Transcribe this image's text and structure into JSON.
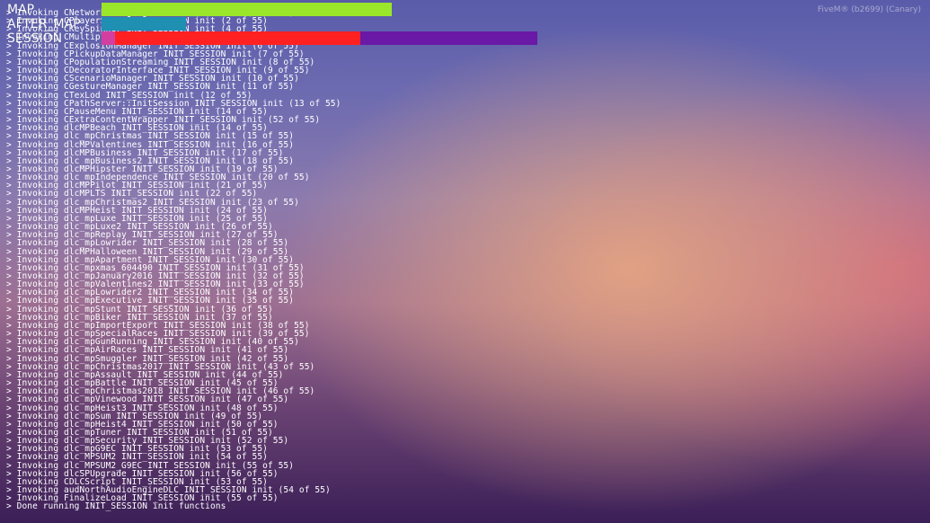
{
  "build_label": "FiveM® (b2699) (Canary)",
  "progress": {
    "map": {
      "label": "MAP",
      "fraction": 1.0,
      "color": "#9ae62a"
    },
    "after_map": {
      "label": "AFTER_MAP",
      "fraction": 0.42,
      "color": "#1f8fb2"
    },
    "session": {
      "label": "SESSION",
      "fraction": 0.59,
      "color": "#ff2121",
      "track_color": "#6a18a6"
    }
  },
  "log_lines": [
    "> Invoking CNetworkDebugMsg INIT_SESSION init (1 of 55)",
    "> Invoking CPlayerSync INIT_SESSION init (2 of 55)",
    "> Invoking CKeySpinner INIT_SESSION init (4 of 55)",
    "> Invoking CMultiplayerGamerTagHud INIT_SESSION init (5 of 55)",
    "> Invoking CExplosionManager INIT_SESSION init (6 of 55)",
    "> Invoking CPickupDataManager INIT_SESSION init (7 of 55)",
    "> Invoking CPopulationStreaming INIT_SESSION init (8 of 55)",
    "> Invoking CDecoratorInterface INIT_SESSION init (9 of 55)",
    "> Invoking CScenarioManager INIT_SESSION init (10 of 55)",
    "> Invoking CGestureManager INIT_SESSION init (11 of 55)",
    "> Invoking CTexLod INIT_SESSION init (12 of 55)",
    "> Invoking CPathServer::InitSession INIT_SESSION init (13 of 55)",
    "> Invoking CPauseMenu INIT_SESSION init (14 of 55)",
    "> Invoking CExtraContentWrapper INIT_SESSION init (52 of 55)",
    "> Invoking dlcMPBeach INIT_SESSION init (14 of 55)",
    "> Invoking dlc_mpChristmas INIT_SESSION init (15 of 55)",
    "> Invoking dlcMPValentines INIT_SESSION init (16 of 55)",
    "> Invoking dlcMPBusiness INIT_SESSION init (17 of 55)",
    "> Invoking dlc_mpBusiness2 INIT_SESSION init (18 of 55)",
    "> Invoking dlcMPHipster INIT_SESSION init (19 of 55)",
    "> Invoking dlc_mpIndependence INIT_SESSION init (20 of 55)",
    "> Invoking dlcMPPilot INIT_SESSION init (21 of 55)",
    "> Invoking dlcMPLTS INIT_SESSION init (22 of 55)",
    "> Invoking dlc_mpChristmas2 INIT_SESSION init (23 of 55)",
    "> Invoking dlcMPHeist INIT_SESSION init (24 of 55)",
    "> Invoking dlc_mpLuxe INIT_SESSION init (25 of 55)",
    "> Invoking dlc_mpLuxe2 INIT_SESSION init (26 of 55)",
    "> Invoking dlc_mpReplay INIT_SESSION init (27 of 55)",
    "> Invoking dlc_mpLowrider INIT_SESSION init (28 of 55)",
    "> Invoking dlcMPHalloween INIT_SESSION init (29 of 55)",
    "> Invoking dlc_mpApartment INIT_SESSION init (30 of 55)",
    "> Invoking dlc_mpxmas_604490 INIT_SESSION init (31 of 55)",
    "> Invoking dlc_mpJanuary2016 INIT_SESSION init (32 of 55)",
    "> Invoking dlc_mpValentines2 INIT_SESSION init (33 of 55)",
    "> Invoking dlc_mpLowrider2 INIT_SESSION init (34 of 55)",
    "> Invoking dlc_mpExecutive INIT_SESSION init (35 of 55)",
    "> Invoking dlc_mpStunt INIT_SESSION init (36 of 55)",
    "> Invoking dlc_mpBiker INIT_SESSION init (37 of 55)",
    "> Invoking dlc_mpImportExport INIT_SESSION init (38 of 55)",
    "> Invoking dlc_mpSpecialRaces INIT_SESSION init (39 of 55)",
    "> Invoking dlc_mpGunRunning INIT_SESSION init (40 of 55)",
    "> Invoking dlc_mpAirRaces INIT_SESSION init (41 of 55)",
    "> Invoking dlc_mpSmuggler INIT_SESSION init (42 of 55)",
    "> Invoking dlc_mpChristmas2017 INIT_SESSION init (43 of 55)",
    "> Invoking dlc_mpAssault INIT_SESSION init (44 of 55)",
    "> Invoking dlc_mpBattle INIT_SESSION init (45 of 55)",
    "> Invoking dlc_mpChristmas2018 INIT_SESSION init (46 of 55)",
    "> Invoking dlc_mpVinewood INIT_SESSION init (47 of 55)",
    "> Invoking dlc_mpHeist3 INIT_SESSION init (48 of 55)",
    "> Invoking dlc_mpSum INIT_SESSION init (49 of 55)",
    "> Invoking dlc_mpHeist4 INIT_SESSION init (50 of 55)",
    "> Invoking dlc_mpTuner INIT_SESSION init (51 of 55)",
    "> Invoking dlc_mpSecurity INIT_SESSION init (52 of 55)",
    "> Invoking dlc_mpG9EC INIT_SESSION init (53 of 55)",
    "> Invoking dlc_MPSUM2 INIT_SESSION init (54 of 55)",
    "> Invoking dlc_MPSUM2_G9EC INIT_SESSION init (55 of 55)",
    "> Invoking dlcSPUpgrade INIT_SESSION init (56 of 55)",
    "> Invoking CDLCScript INIT_SESSION init (53 of 55)",
    "> Invoking audNorthAudioEngineDLC INIT_SESSION init (54 of 55)",
    "> Invoking FinalizeLoad INIT_SESSION init (55 of 55)",
    "> Done running INIT_SESSION init functions"
  ]
}
